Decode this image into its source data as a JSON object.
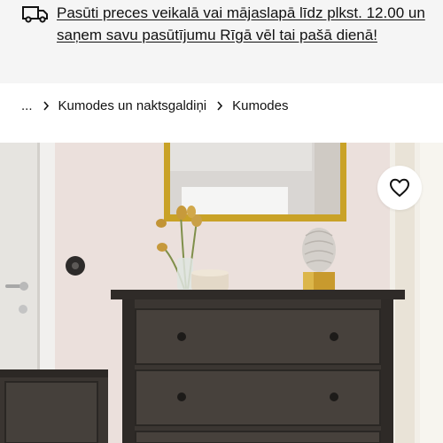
{
  "banner": {
    "icon": "delivery-truck-icon",
    "text": "Pasūti preces veikalā vai mājaslapā līdz plkst. 12.00 un saņem savu pasūtījumu Rīgā vēl tai pašā dienā!"
  },
  "breadcrumb": {
    "ellipsis": "...",
    "items": [
      "Kumodes un naktsgaldiņi",
      "Kumodes"
    ]
  },
  "hero": {
    "image": "product-photo-dresser",
    "favorite_icon": "heart-icon",
    "colors": {
      "wall": "#ece1dd",
      "dresser": "#3b3632",
      "mirror_frame": "#c9a227"
    }
  }
}
